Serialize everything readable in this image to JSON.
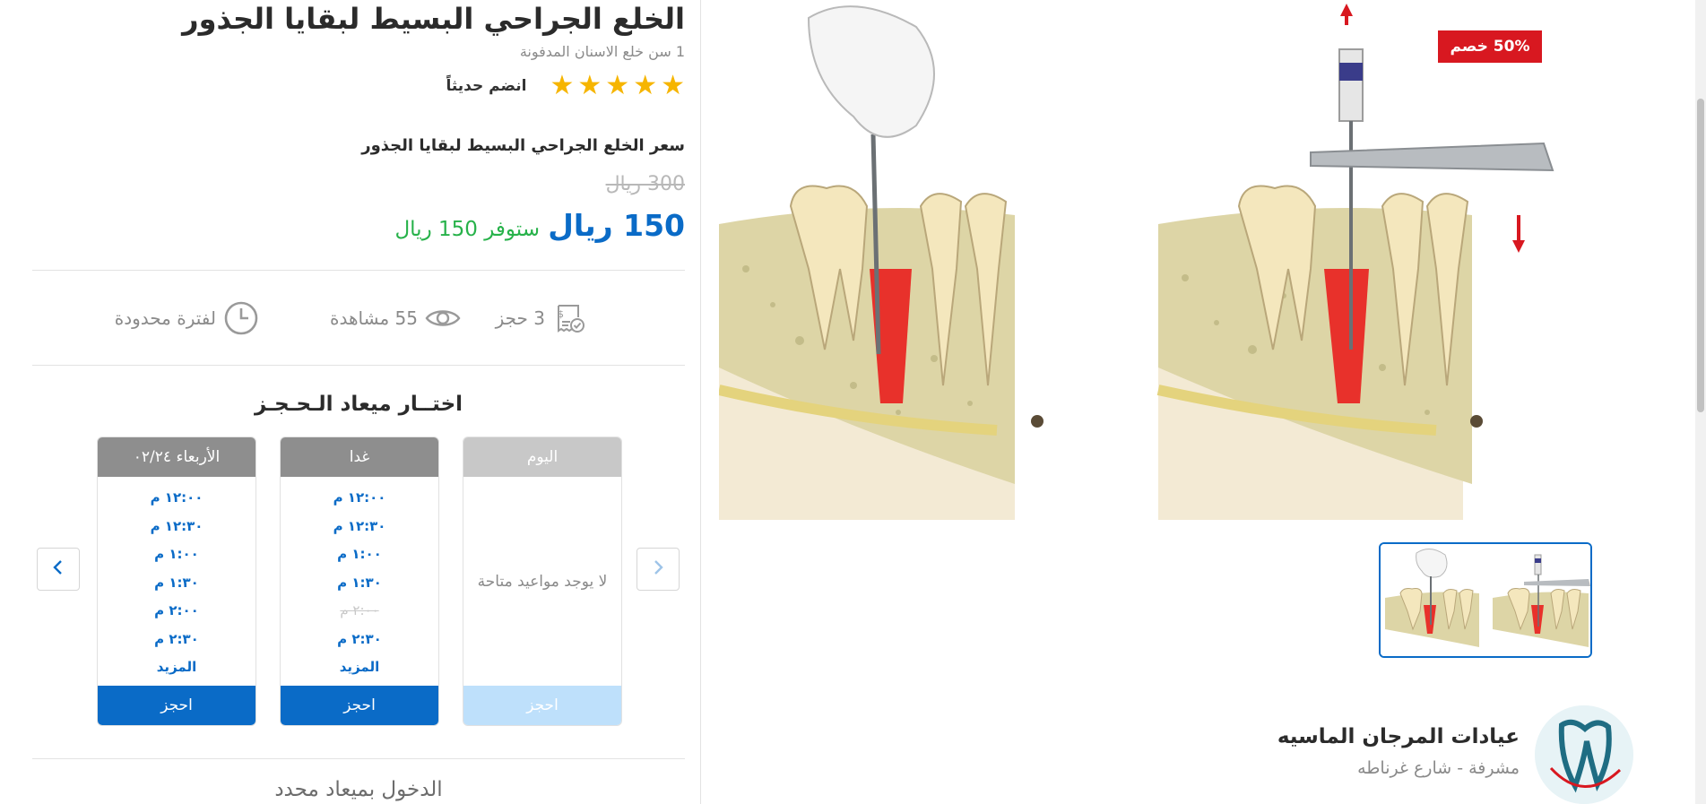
{
  "product": {
    "title": "الخلع الجراحي البسيط لبقايا الجذور",
    "subtitle": "1 سن خلع الاسنان المدفونة",
    "rating_stars": 5,
    "join_label": "انضم حديثاً"
  },
  "pricing": {
    "price_title": "سعر الخلع الجراحي البسيط لبقايا الجذور",
    "old_price": "300 ريال",
    "new_price": "150 ريال",
    "savings": "ستوفر 150 ريال"
  },
  "stats": {
    "bookings": "3 حجز",
    "views": "55 مشاهدة",
    "limited": "لفترة محدودة"
  },
  "booking": {
    "section_title": "اختــار ميعاد الـحـجـز",
    "days": [
      {
        "label": "اليوم",
        "empty_text": "لا يوجد مواعيد متاحة",
        "slots": [],
        "book_label": "احجز",
        "available": false
      },
      {
        "label": "غدا",
        "slots": [
          {
            "time": "١٢:٠٠ م",
            "available": true
          },
          {
            "time": "١٢:٣٠ م",
            "available": true
          },
          {
            "time": "١:٠٠ م",
            "available": true
          },
          {
            "time": "١:٣٠ م",
            "available": true
          },
          {
            "time": "٢:٠٠ م",
            "available": false
          },
          {
            "time": "٢:٣٠ م",
            "available": true
          }
        ],
        "more_label": "المزيد",
        "book_label": "احجز",
        "available": true
      },
      {
        "label": "الأربعاء ٠٢/٢٤",
        "slots": [
          {
            "time": "١٢:٠٠ م",
            "available": true
          },
          {
            "time": "١٢:٣٠ م",
            "available": true
          },
          {
            "time": "١:٠٠ م",
            "available": true
          },
          {
            "time": "١:٣٠ م",
            "available": true
          },
          {
            "time": "٢:٠٠ م",
            "available": true
          },
          {
            "time": "٢:٣٠ م",
            "available": true
          }
        ],
        "more_label": "المزيد",
        "book_label": "احجز",
        "available": true
      }
    ],
    "walkin_label": "الدخول بميعاد محدد"
  },
  "gallery": {
    "discount_badge": "50% خصم",
    "main_image_icon": "dental-extraction-illustration",
    "thumbnail_icon": "dental-extraction-thumbnail"
  },
  "clinic": {
    "name": "عيادات المرجان الماسيه",
    "location": "مشرفة - شارع غرناطه",
    "logo_icon": "tooth-logo-icon"
  },
  "colors": {
    "primary": "#0a6bc7",
    "success": "#27b24a",
    "star": "#f6b500",
    "badge": "#d81820",
    "disabled_button": "#bee0fb"
  }
}
